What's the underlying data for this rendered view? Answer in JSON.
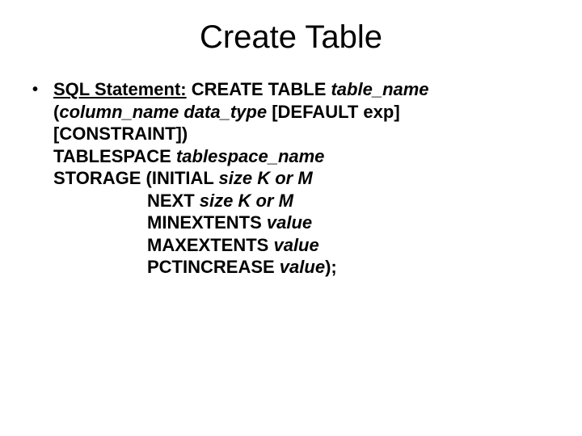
{
  "title": "Create Table",
  "bullet_glyph": "•",
  "label": "SQL Statement:",
  "sp": " ",
  "l1": {
    "a": "CREATE TABLE ",
    "b": "table_name"
  },
  "l2": {
    "a": "(",
    "b": "column_name  data_type",
    "c": " [DEFAULT exp]"
  },
  "l3": "[CONSTRAINT])",
  "l4": {
    "a": "TABLESPACE ",
    "b": "tablespace_name"
  },
  "l5": {
    "a": "STORAGE (INITIAL ",
    "b": "size K or M"
  },
  "l6": {
    "a": "NEXT ",
    "b": "size K or M"
  },
  "l7": {
    "a": "MINEXTENTS ",
    "b": "value"
  },
  "l8": {
    "a": "MAXEXTENTS ",
    "b": "value"
  },
  "l9": {
    "a": "PCTINCREASE ",
    "b": "value",
    "c": ");"
  }
}
